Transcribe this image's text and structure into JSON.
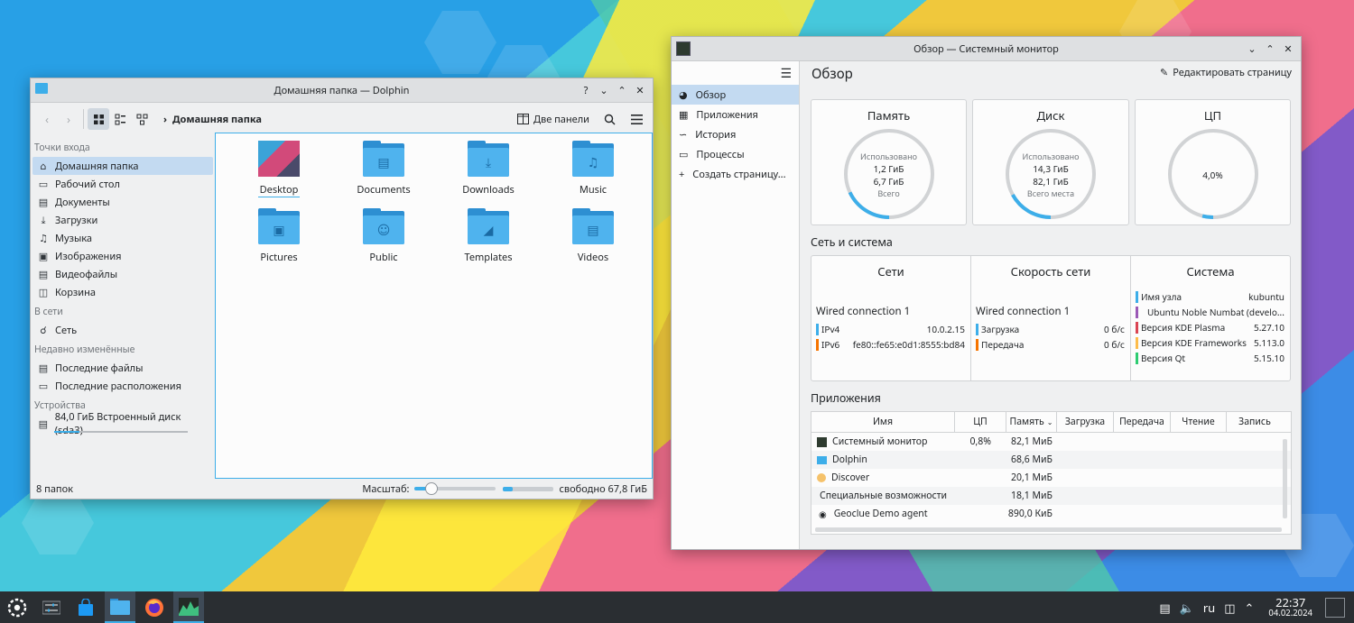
{
  "dolphin": {
    "title": "Домашняя папка — Dolphin",
    "breadcrumb": "Домашняя папка",
    "split_label": "Две панели",
    "places": {
      "sections": [
        {
          "header": "Точки входа",
          "items": [
            "Домашняя папка",
            "Рабочий стол",
            "Документы",
            "Загрузки",
            "Музыка",
            "Изображения",
            "Видеофайлы",
            "Корзина"
          ]
        },
        {
          "header": "В сети",
          "items": [
            "Сеть"
          ]
        },
        {
          "header": "Недавно изменённые",
          "items": [
            "Последние файлы",
            "Последние расположения"
          ]
        },
        {
          "header": "Устройства",
          "items": [
            "84,0 ГиБ Встроенный диск (sda3)"
          ]
        }
      ]
    },
    "files": [
      "Desktop",
      "Documents",
      "Downloads",
      "Music",
      "Pictures",
      "Public",
      "Templates",
      "Videos"
    ],
    "status": {
      "count": "8 папок",
      "zoom_label": "Масштаб:",
      "free_space": "свободно 67,8 ГиБ",
      "zoom_level": 0.2,
      "disk_used": 0.19
    }
  },
  "sysmon": {
    "title": "Обзор — Системный монитор",
    "page_title": "Обзор",
    "edit_page": "Редактировать страницу",
    "nav": [
      "Обзор",
      "Приложения",
      "История",
      "Процессы",
      "Создать страницу..."
    ],
    "gauges": [
      {
        "title": "Память",
        "lines": [
          "Использовано",
          "1,2 ГиБ",
          "6,7 ГиБ",
          "Всего"
        ],
        "fraction": 0.18
      },
      {
        "title": "Диск",
        "lines": [
          "Использовано",
          "14,3 ГиБ",
          "82,1 ГиБ",
          "Всего места"
        ],
        "fraction": 0.17
      },
      {
        "title": "ЦП",
        "lines": [
          "4,0%"
        ],
        "fraction": 0.04
      }
    ],
    "section_net": "Сеть и система",
    "networks": {
      "title": "Сети",
      "connection": "Wired connection 1",
      "rows": [
        {
          "k": "IPv4",
          "v": "10.0.2.15",
          "color": "#3daee9"
        },
        {
          "k": "IPv6",
          "v": "fe80::fe65:e0d1:8555:bd84",
          "color": "#f67400"
        }
      ]
    },
    "speed": {
      "title": "Скорость сети",
      "connection": "Wired connection 1",
      "rows": [
        {
          "k": "Загрузка",
          "v": "0 б/с",
          "color": "#3daee9"
        },
        {
          "k": "Передача",
          "v": "0 б/с",
          "color": "#f67400"
        }
      ]
    },
    "system": {
      "title": "Система",
      "rows": [
        {
          "k": "Имя узла",
          "v": "kubuntu",
          "color": "#3daee9"
        },
        {
          "k": "Ubuntu Noble Numbat (develo...",
          "v": "",
          "color": "#9b59b6"
        },
        {
          "k": "Версия KDE Plasma",
          "v": "5.27.10",
          "color": "#da4453"
        },
        {
          "k": "Версия KDE Frameworks",
          "v": "5.113.0",
          "color": "#fdbc4b"
        },
        {
          "k": "Версия Qt",
          "v": "5.15.10",
          "color": "#2ecc71"
        }
      ]
    },
    "section_apps": "Приложения",
    "app_columns": [
      "Имя",
      "ЦП",
      "Память",
      "Загрузка",
      "Передача",
      "Чтение",
      "Запись"
    ],
    "apps": [
      {
        "name": "Системный монитор",
        "cpu": "0,8%",
        "mem": "82,1 МиБ",
        "icon": "sysmon-icon"
      },
      {
        "name": "Dolphin",
        "cpu": "",
        "mem": "68,6 МиБ",
        "icon": "folder-icon"
      },
      {
        "name": "Discover",
        "cpu": "",
        "mem": "20,1 МиБ",
        "icon": "discover-icon"
      },
      {
        "name": "Специальные возможности",
        "cpu": "",
        "mem": "18,1 МиБ",
        "icon": ""
      },
      {
        "name": "Geoclue Demo agent",
        "cpu": "",
        "mem": "890,0 КиБ",
        "icon": "location-icon"
      }
    ]
  },
  "taskbar": {
    "lang": "ru",
    "time": "22:37",
    "date": "04.02.2024"
  }
}
